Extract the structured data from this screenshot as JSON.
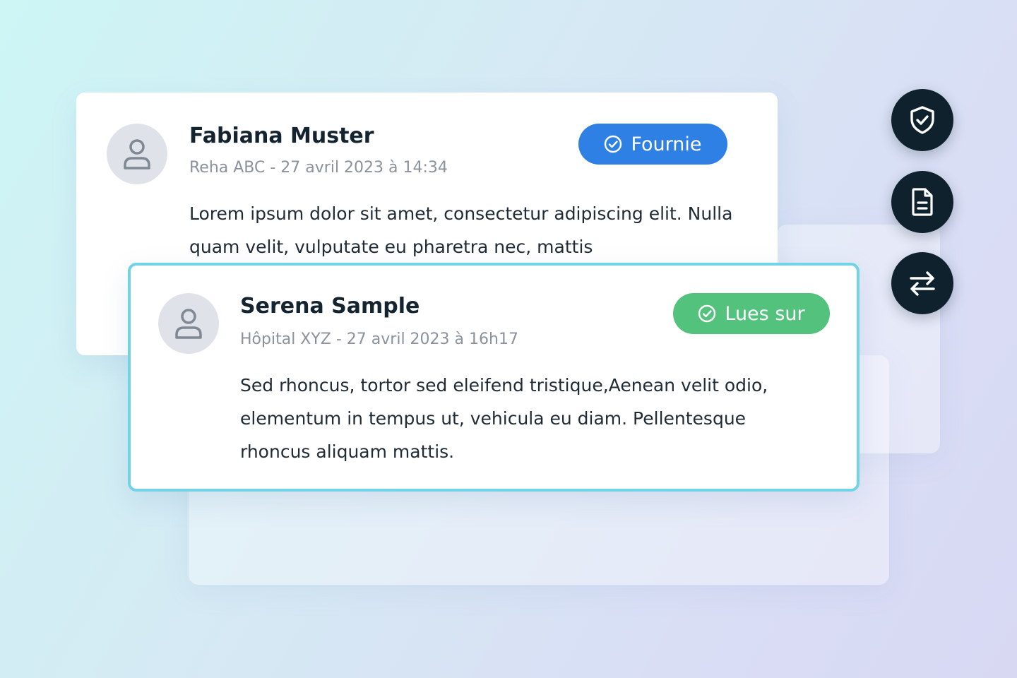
{
  "messages": [
    {
      "name": "Fabiana Muster",
      "meta": "Reha ABC - 27 avril 2023 à 14:34",
      "status": "Fournie",
      "status_color": "#2f80e4",
      "body": "Lorem ipsum dolor sit amet, consectetur adipiscing elit. Nulla quam velit, vulputate eu pharetra nec, mattis"
    },
    {
      "name": "Serena Sample",
      "meta": "Hôpital XYZ - 27 avril 2023 à 16h17",
      "status": "Lues sur",
      "status_color": "#52c27c",
      "body": "Sed rhoncus, tortor sed eleifend tristique,Aenean velit odio, elementum in tempus ut, vehicula eu diam. Pellentesque rhoncus aliquam mattis."
    }
  ],
  "side_actions": [
    {
      "icon": "shield-check-icon"
    },
    {
      "icon": "document-icon"
    },
    {
      "icon": "swap-arrows-icon"
    }
  ],
  "colors": {
    "highlight_border": "#72d2e6",
    "fab_background": "#0f212c"
  }
}
